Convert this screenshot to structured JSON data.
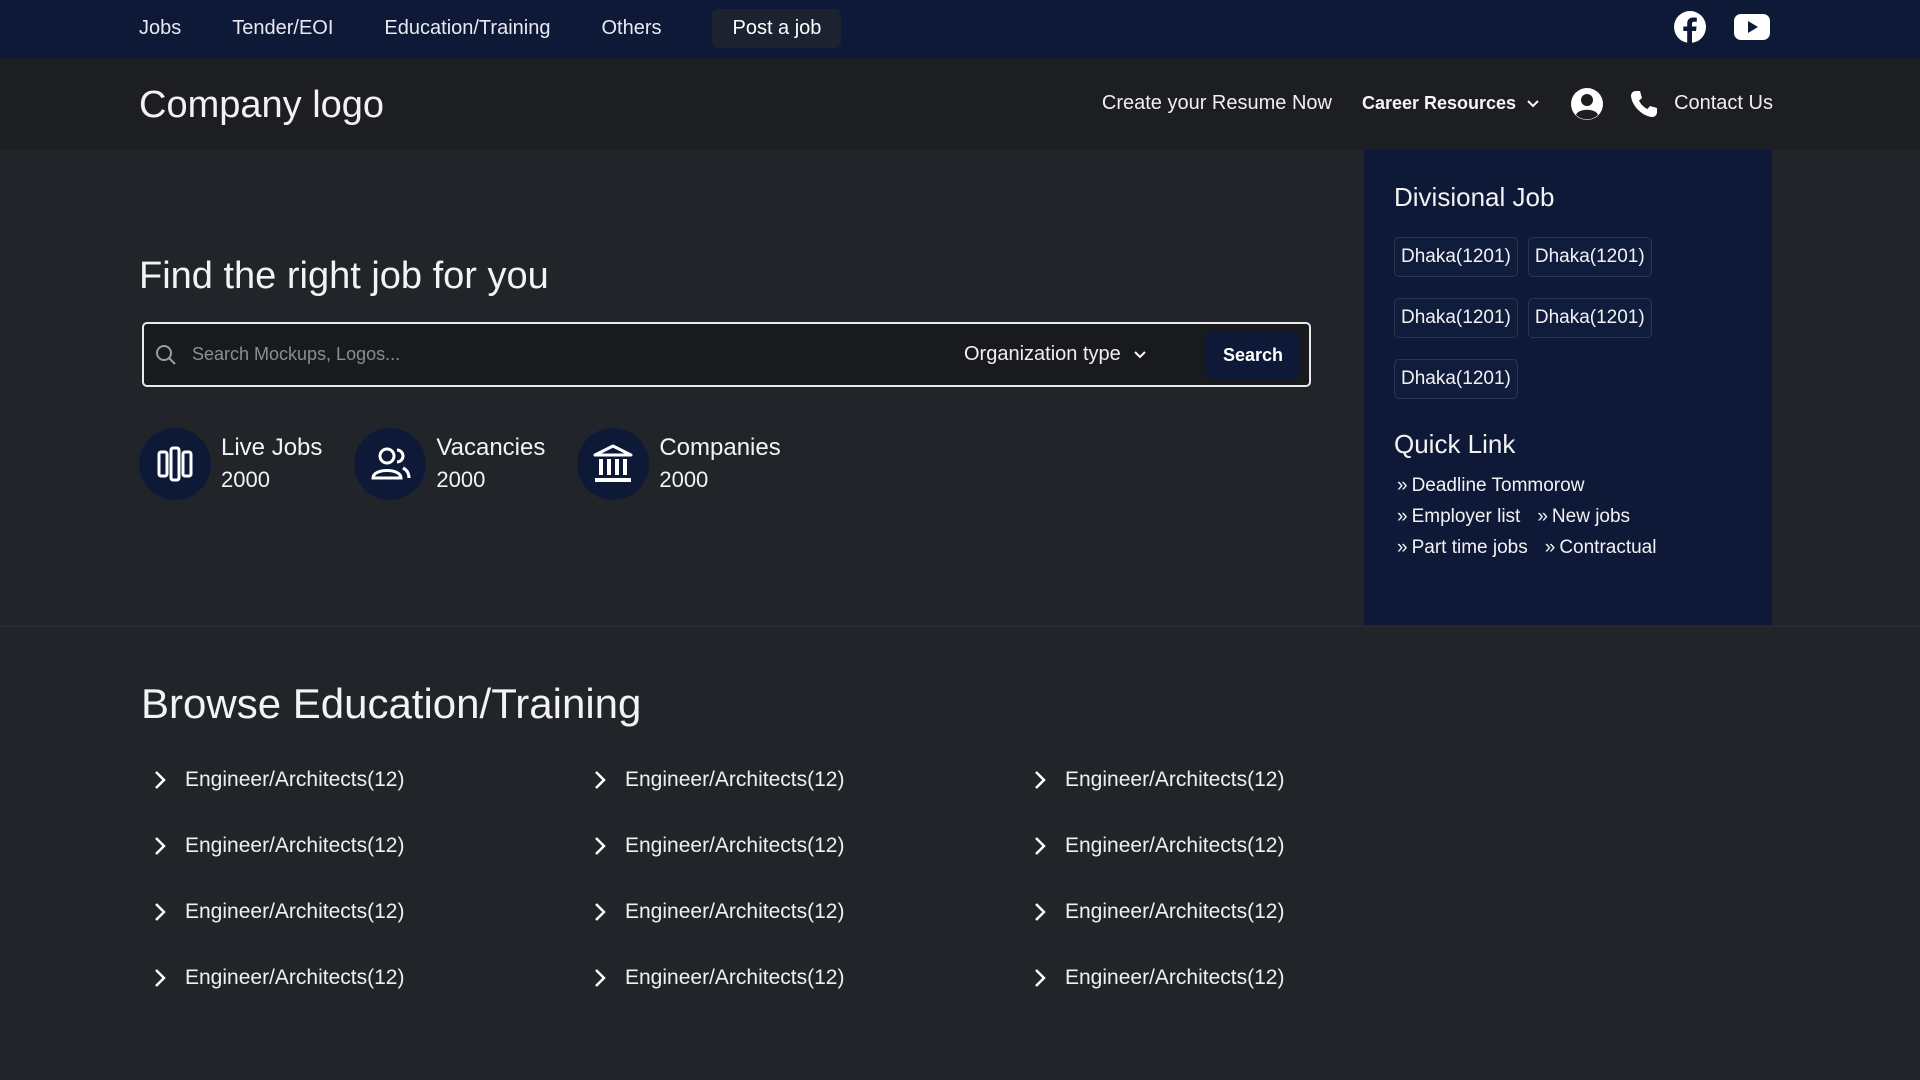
{
  "topnav": {
    "items": [
      "Jobs",
      "Tender/EOI",
      "Education/Training",
      "Others"
    ],
    "post_job": "Post a job",
    "social": [
      "facebook-icon",
      "youtube-icon"
    ]
  },
  "header": {
    "logo": "Company logo",
    "resume": "Create your Resume Now",
    "career": "Career Resources",
    "contact": "Contact Us"
  },
  "hero": {
    "title": "Find the right job for you",
    "search_placeholder": "Search Mockups, Logos...",
    "org_type": "Organization type",
    "search_button": "Search",
    "stats": [
      {
        "label": "Live Jobs",
        "value": "2000",
        "icon": "live-jobs-icon"
      },
      {
        "label": "Vacancies",
        "value": "2000",
        "icon": "vacancies-icon"
      },
      {
        "label": "Companies",
        "value": "2000",
        "icon": "companies-icon"
      }
    ]
  },
  "panel": {
    "divisional_title": "Divisional Job",
    "divisions": [
      "Dhaka(1201)",
      "Dhaka(1201)",
      "Dhaka(1201)",
      "Dhaka(1201)",
      "Dhaka(1201)"
    ],
    "quick_title": "Quick Link",
    "quick_links": [
      "Deadline Tommorow",
      "Employer list",
      "New jobs",
      "Part time jobs",
      "Contractual"
    ]
  },
  "browse": {
    "title": "Browse Education/Training",
    "items": [
      "Engineer/Architects(12)",
      "Engineer/Architects(12)",
      "Engineer/Architects(12)",
      "Engineer/Architects(12)",
      "Engineer/Architects(12)",
      "Engineer/Architects(12)",
      "Engineer/Architects(12)",
      "Engineer/Architects(12)",
      "Engineer/Architects(12)",
      "Engineer/Architects(12)",
      "Engineer/Architects(12)",
      "Engineer/Architects(12)"
    ]
  },
  "colors": {
    "navy": "#0d1937",
    "background": "#212429",
    "header": "#1c1e22"
  }
}
